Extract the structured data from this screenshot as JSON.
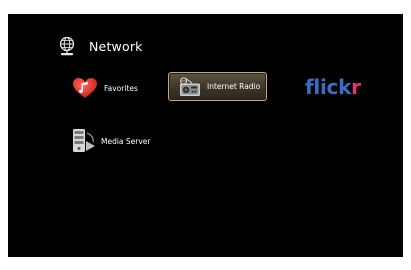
{
  "header": {
    "icon": "globe-network-icon",
    "title": "Network"
  },
  "items": {
    "favorites": {
      "label": "Favorites",
      "icon": "heart-music-icon"
    },
    "internet_radio": {
      "label": "Internet Radio",
      "icon": "radio-icon",
      "selected": true
    },
    "flickr": {
      "brand_main": "flick",
      "brand_accent": "r",
      "icon": "flickr-logo"
    },
    "media_server": {
      "label": "Media Server",
      "icon": "media-server-icon"
    }
  },
  "colors": {
    "background": "#000000",
    "text": "#ffffff",
    "selection_border": "#b9a98a",
    "flickr_blue": "#3b6ec2",
    "flickr_pink": "#e8316f",
    "heart_red": "#e0302c"
  }
}
